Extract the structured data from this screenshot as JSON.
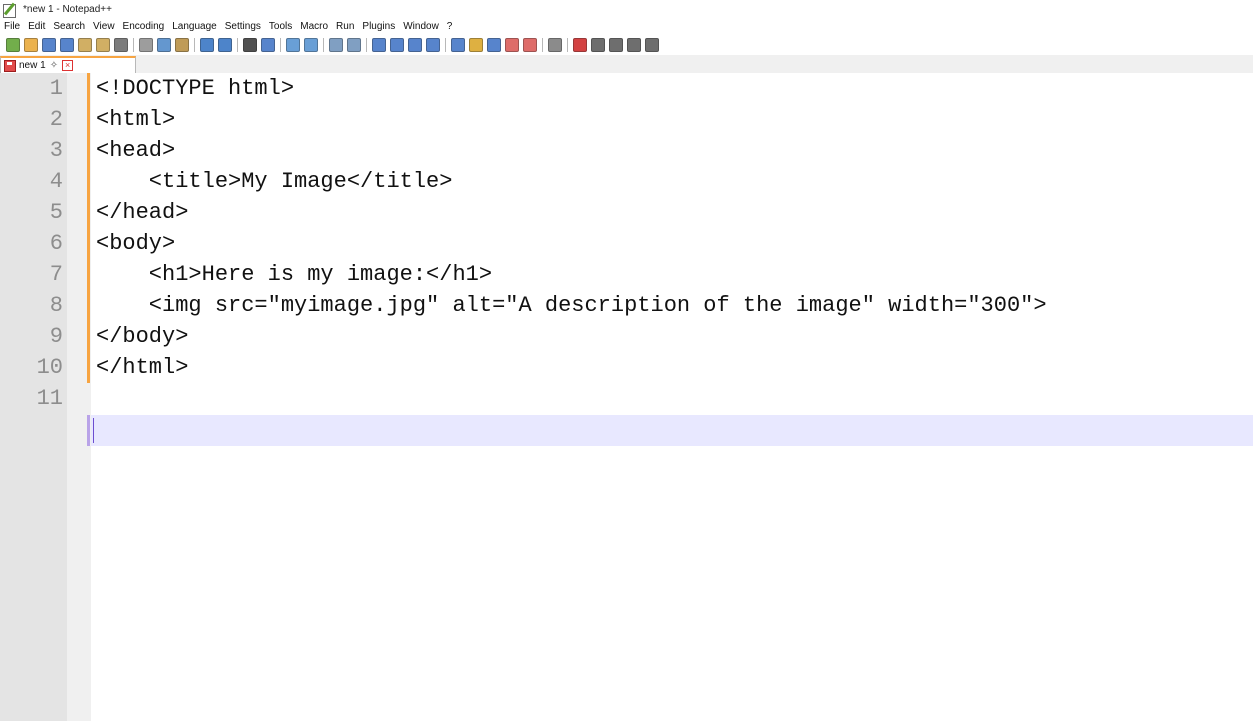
{
  "window": {
    "title": "*new 1 - Notepad++"
  },
  "menu": [
    "File",
    "Edit",
    "Search",
    "View",
    "Encoding",
    "Language",
    "Settings",
    "Tools",
    "Macro",
    "Run",
    "Plugins",
    "Window",
    "?"
  ],
  "toolbar_icons": [
    {
      "name": "new-file-icon",
      "color": "#5aa02c"
    },
    {
      "name": "open-file-icon",
      "color": "#e8a530"
    },
    {
      "name": "save-icon",
      "color": "#3a6fc4"
    },
    {
      "name": "save-all-icon",
      "color": "#3a6fc4"
    },
    {
      "name": "close-icon",
      "color": "#c9a24a"
    },
    {
      "name": "close-all-icon",
      "color": "#c9a24a"
    },
    {
      "name": "print-icon",
      "color": "#666666"
    },
    "sep",
    {
      "name": "cut-icon",
      "color": "#8c8c8c"
    },
    {
      "name": "copy-icon",
      "color": "#4a86c7"
    },
    {
      "name": "paste-icon",
      "color": "#b48a3a"
    },
    "sep",
    {
      "name": "undo-icon",
      "color": "#2f6fc1"
    },
    {
      "name": "redo-icon",
      "color": "#2f6fc1"
    },
    "sep",
    {
      "name": "find-icon",
      "color": "#333333"
    },
    {
      "name": "replace-icon",
      "color": "#3a6fc4"
    },
    "sep",
    {
      "name": "zoom-in-icon",
      "color": "#4f8fcf"
    },
    {
      "name": "zoom-out-icon",
      "color": "#4f8fcf"
    },
    "sep",
    {
      "name": "sync-vertical-icon",
      "color": "#6b8fb8"
    },
    {
      "name": "sync-horizontal-icon",
      "color": "#6b8fb8"
    },
    "sep",
    {
      "name": "word-wrap-icon",
      "color": "#3a6fc4"
    },
    {
      "name": "show-all-chars-icon",
      "color": "#3a6fc4"
    },
    {
      "name": "indent-guide-icon",
      "color": "#3a6fc4"
    },
    {
      "name": "doc-map-icon",
      "color": "#3a6fc4"
    },
    "sep",
    {
      "name": "udl-icon",
      "color": "#3a6fc4"
    },
    {
      "name": "doc-list-icon",
      "color": "#d9a321"
    },
    {
      "name": "function-list-icon",
      "color": "#3a6fc4"
    },
    {
      "name": "folder-workspace-icon",
      "color": "#d9534f"
    },
    {
      "name": "monitoring-icon",
      "color": "#d9534f"
    },
    "sep",
    {
      "name": "macro-record-icon",
      "color": "#777777"
    },
    "sep",
    {
      "name": "macro-start-icon",
      "color": "#cc2222"
    },
    {
      "name": "macro-stop-icon",
      "color": "#555555"
    },
    {
      "name": "macro-play-icon",
      "color": "#555555"
    },
    {
      "name": "macro-run-multiple-icon",
      "color": "#555555"
    },
    {
      "name": "macro-save-icon",
      "color": "#555555"
    }
  ],
  "tab": {
    "label": "new 1",
    "pin": "✧",
    "close": "×"
  },
  "lines": [
    "1",
    "2",
    "3",
    "4",
    "5",
    "6",
    "7",
    "8",
    "9",
    "10",
    "11"
  ],
  "code": [
    "<!DOCTYPE html>",
    "<html>",
    "<head>",
    "    <title>My Image</title>",
    "</head>",
    "<body>",
    "    <h1>Here is my image:</h1>",
    "    <img src=\"myimage.jpg\" alt=\"A description of the image\" width=\"300\">",
    "</body>",
    "</html>",
    ""
  ]
}
